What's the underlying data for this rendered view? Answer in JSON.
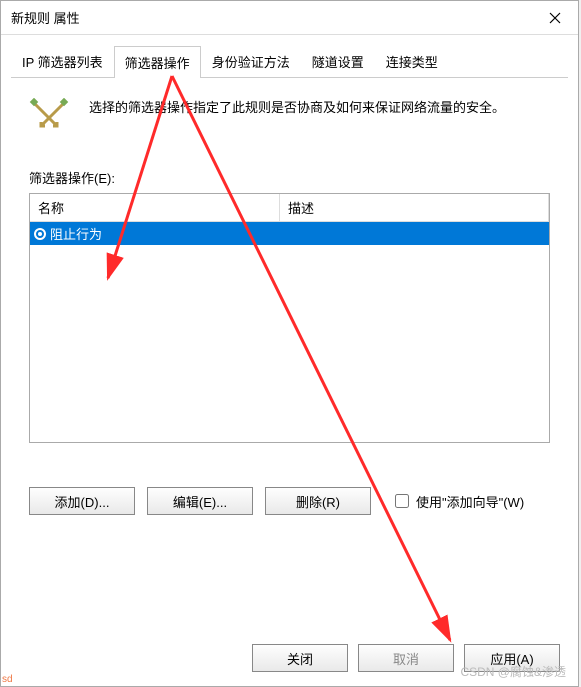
{
  "window": {
    "title": "新规则 属性"
  },
  "tabs": [
    {
      "label": "IP 筛选器列表"
    },
    {
      "label": "筛选器操作"
    },
    {
      "label": "身份验证方法"
    },
    {
      "label": "隧道设置"
    },
    {
      "label": "连接类型"
    }
  ],
  "activeTabIndex": 1,
  "description": "选择的筛选器操作指定了此规则是否协商及如何来保证网络流量的安全。",
  "section": {
    "label": "筛选器操作(E):"
  },
  "list": {
    "headers": {
      "name": "名称",
      "desc": "描述"
    },
    "rows": [
      {
        "name": "阻止行为",
        "desc": "",
        "selected": true
      }
    ]
  },
  "buttons": {
    "add": "添加(D)...",
    "edit": "编辑(E)...",
    "remove": "删除(R)",
    "close": "关闭",
    "cancel": "取消",
    "apply": "应用(A)"
  },
  "wizard": {
    "label": "使用\"添加向导\"(W)",
    "checked": false
  },
  "watermark": "CSDN @腐蚀&渗透",
  "corner": "sd"
}
